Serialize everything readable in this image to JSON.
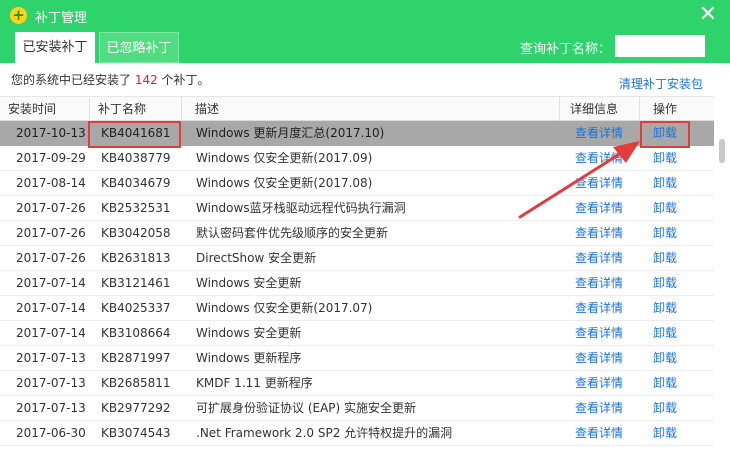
{
  "window": {
    "title": "补丁管理",
    "icon": "plus-icon",
    "close_glyph": "✕"
  },
  "tabs": [
    {
      "label": "已安装补丁"
    },
    {
      "label": "已忽略补丁"
    }
  ],
  "search": {
    "label": "查询补丁名称：",
    "value": ""
  },
  "summary": {
    "prefix": "您的系统中已经安装了 ",
    "count": "142",
    "suffix": " 个补丁。"
  },
  "clear_link": "清理补丁安装包",
  "columns": {
    "date": "安装时间",
    "kb": "补丁名称",
    "desc": "描述",
    "detail": "详细信息",
    "op": "操作"
  },
  "rows": [
    {
      "date": "2017-10-13",
      "kb": "KB4041681",
      "desc": "Windows 更新月度汇总(2017.10)",
      "detail": "查看详情",
      "op": "卸载"
    },
    {
      "date": "2017-09-29",
      "kb": "KB4038779",
      "desc": "Windows 仅安全更新(2017.09)",
      "detail": "查看详情",
      "op": "卸载"
    },
    {
      "date": "2017-08-14",
      "kb": "KB4034679",
      "desc": "Windows 仅安全更新(2017.08)",
      "detail": "查看详情",
      "op": "卸载"
    },
    {
      "date": "2017-07-26",
      "kb": "KB2532531",
      "desc": "Windows蓝牙栈驱动远程代码执行漏洞",
      "detail": "查看详情",
      "op": "卸载"
    },
    {
      "date": "2017-07-26",
      "kb": "KB3042058",
      "desc": "默认密码套件优先级顺序的安全更新",
      "detail": "查看详情",
      "op": "卸载"
    },
    {
      "date": "2017-07-26",
      "kb": "KB2631813",
      "desc": "DirectShow 安全更新",
      "detail": "查看详情",
      "op": "卸载"
    },
    {
      "date": "2017-07-14",
      "kb": "KB3121461",
      "desc": "Windows 安全更新",
      "detail": "查看详情",
      "op": "卸载"
    },
    {
      "date": "2017-07-14",
      "kb": "KB4025337",
      "desc": "Windows 仅安全更新(2017.07)",
      "detail": "查看详情",
      "op": "卸载"
    },
    {
      "date": "2017-07-14",
      "kb": "KB3108664",
      "desc": "Windows 安全更新",
      "detail": "查看详情",
      "op": "卸载"
    },
    {
      "date": "2017-07-13",
      "kb": "KB2871997",
      "desc": "Windows 更新程序",
      "detail": "查看详情",
      "op": "卸载"
    },
    {
      "date": "2017-07-13",
      "kb": "KB2685811",
      "desc": "KMDF 1.11 更新程序",
      "detail": "查看详情",
      "op": "卸载"
    },
    {
      "date": "2017-07-13",
      "kb": "KB2977292",
      "desc": "可扩展身份验证协议 (EAP) 实施安全更新",
      "detail": "查看详情",
      "op": "卸载"
    },
    {
      "date": "2017-06-30",
      "kb": "KB3074543",
      "desc": ".Net Framework 2.0 SP2 允许特权提升的漏洞",
      "detail": "查看详情",
      "op": "卸载"
    }
  ],
  "selected_row": 0,
  "colors": {
    "accent": "#2ed36b",
    "link": "#1a73d9",
    "highlight": "#e23b3b",
    "count": "#e02020"
  }
}
